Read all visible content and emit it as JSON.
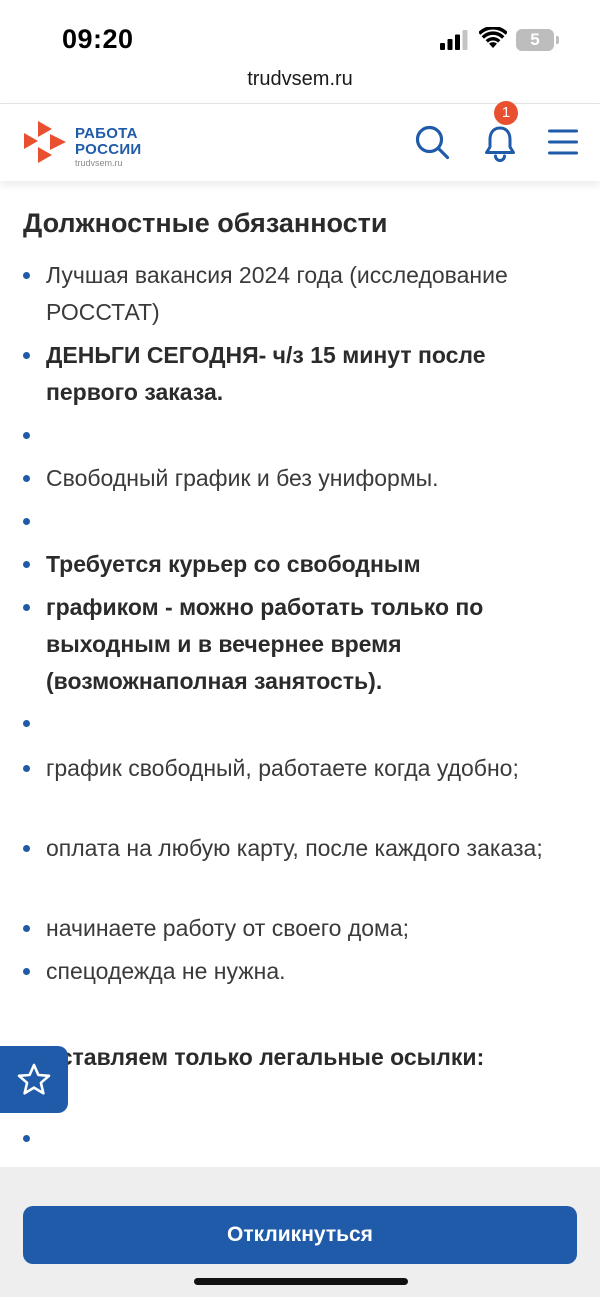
{
  "status_bar": {
    "time": "09:20",
    "battery_level": "5"
  },
  "browser": {
    "url": "trudvsem.ru"
  },
  "header": {
    "logo_line1": "РАБОТА",
    "logo_line2": "РОССИИ",
    "logo_domain": "trudvsem.ru",
    "notification_count": "1",
    "icons": {
      "search": "search-icon",
      "notifications": "bell-icon",
      "menu": "hamburger-menu-icon"
    }
  },
  "section": {
    "title": "Должностные обязанности"
  },
  "duties": [
    {
      "text": "Лучшая вакансия 2024 года (исследование РОССТАТ)",
      "bold": false
    },
    {
      "text": "ДЕНЬГИ СЕГОДНЯ- ч/з 15 минут после первого заказа.",
      "bold": true
    },
    {
      "text": "",
      "bold": false
    },
    {
      "text": "Свободный график и без униформы.",
      "bold": false
    },
    {
      "text": "",
      "bold": false
    },
    {
      "text": "Требуется курьер со свободным",
      "bold": true
    },
    {
      "text": "графиком - можно работать только по выходным и в вечернее время (возможнаполная занятость).",
      "bold": true
    },
    {
      "text": "",
      "bold": false
    },
    {
      "text": " график свободный, работаете когда удобно;",
      "bold": false
    },
    {
      "text": " оплата на любую карту, после каждого заказа;",
      "bold": false
    },
    {
      "text": " начинаете работу от своего дома;",
      "bold": false
    },
    {
      "text": " спецодежда не нужна.",
      "bold": false
    },
    {
      "text": "оставляем только легальные осылки:",
      "bold": true
    },
    {
      "text": "",
      "bold": false
    }
  ],
  "actions": {
    "apply_label": "Откликнуться",
    "favorite_icon": "star-outline-icon"
  },
  "colors": {
    "brand_blue": "#1f5ba8",
    "brand_orange": "#e8502f",
    "bottom_bar": "#eeeeee"
  }
}
